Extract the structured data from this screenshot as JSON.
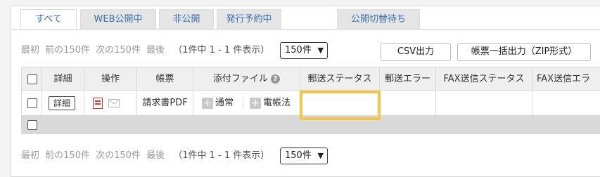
{
  "tabs": [
    {
      "label": "すべて",
      "active": true
    },
    {
      "label": "WEB公開中"
    },
    {
      "label": "非公開"
    },
    {
      "label": "発行予約中"
    },
    {
      "label": "公開切替待ち"
    }
  ],
  "pager": {
    "first": "最初",
    "prev": "前の150件",
    "next": "次の150件",
    "last": "最後",
    "count_text": "（1件中 1 - 1 件表示）",
    "per_page": "150件"
  },
  "buttons": {
    "csv": "CSV出力",
    "bulk": "帳票一括出力（ZIP形式）"
  },
  "table": {
    "headers": {
      "detail": "詳細",
      "action": "操作",
      "form": "帳票",
      "attach": "添付ファイル",
      "mail_status": "郵送ステータス",
      "mail_error": "郵送エラー",
      "fax_status": "FAX送信ステータス",
      "fax_error": "FAX送信エラ"
    },
    "row": {
      "detail_btn": "詳細",
      "form": "請求書PDF",
      "attach_normal": "通常",
      "attach_denchou": "電帳法"
    }
  },
  "colors": {
    "tab_text": "#3a6fb0",
    "highlight": "#f3c64a",
    "pdf_red": "#d9342b"
  }
}
